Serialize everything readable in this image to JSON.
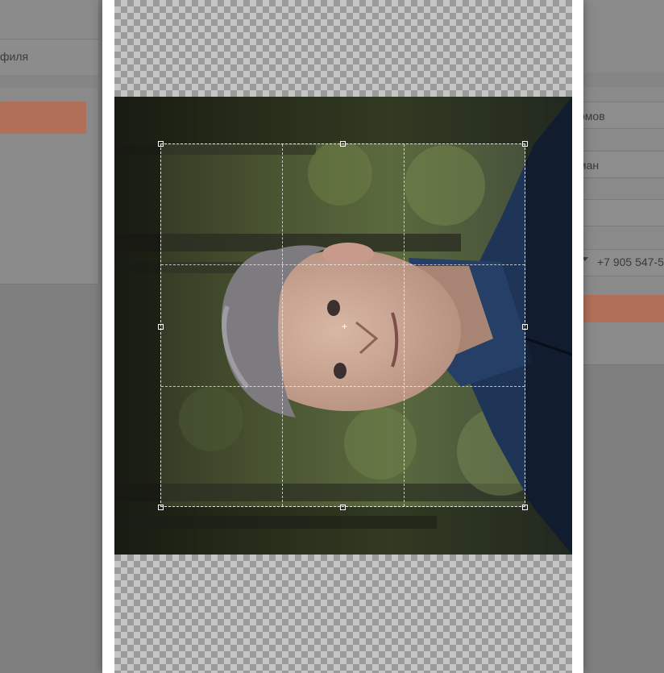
{
  "background": {
    "left_tab_label": "филя",
    "right_fields": [
      "омов",
      "ман",
      "+7 905 547-5"
    ]
  },
  "cropper": {
    "center_marker": "+"
  },
  "colors": {
    "accent": "#b26f58",
    "overlay": "#7f7f7f"
  },
  "icons": [
    "phone-dropdown-caret-icon",
    "crop-center-icon"
  ]
}
